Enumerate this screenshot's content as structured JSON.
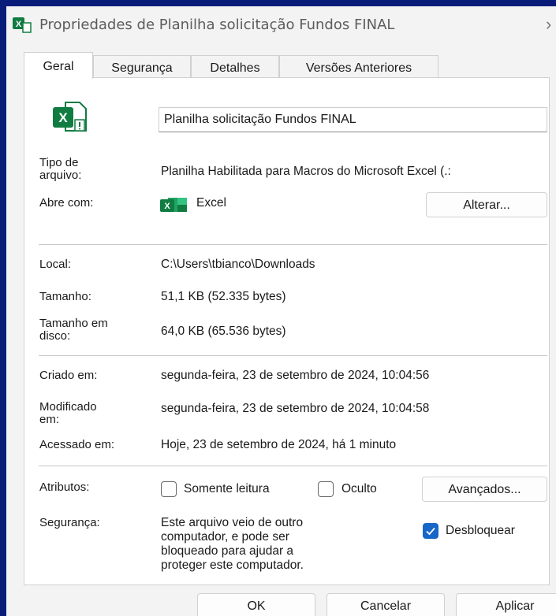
{
  "window": {
    "title": "Propriedades de Planilha solicitação Fundos FINAL",
    "close_glyph": "›"
  },
  "tabs": [
    {
      "label": "Geral",
      "active": true
    },
    {
      "label": "Segurança",
      "active": false
    },
    {
      "label": "Detalhes",
      "active": false
    },
    {
      "label": "Versões Anteriores",
      "active": false
    }
  ],
  "file": {
    "icon": "excel-file-icon",
    "icon_letter": "X",
    "name": "Planilha solicitação Fundos FINAL"
  },
  "type_info": {
    "tipo_label_1": "Tipo de",
    "tipo_label_2": "arquivo:",
    "tipo_value": "Planilha Habilitada para Macros do Microsoft Excel (.:",
    "abre_label": "Abre com:",
    "app_icon": "excel-app-icon",
    "app_icon_letter": "X",
    "app_name": "Excel",
    "change_button": "Alterar..."
  },
  "location": {
    "local_label": "Local:",
    "local_value": "C:\\Users\\tbianco\\Downloads",
    "size_label": "Tamanho:",
    "size_value": "51,1 KB (52.335 bytes)",
    "disk_label_1": "Tamanho em",
    "disk_label_2": "disco:",
    "disk_value": "64,0 KB (65.536 bytes)"
  },
  "dates": {
    "created_label": "Criado em:",
    "created_value": "segunda-feira, 23 de setembro de 2024, 10:04:56",
    "modified_label_1": "Modificado",
    "modified_label_2": "em:",
    "modified_value": "segunda-feira, 23 de setembro de 2024, 10:04:58",
    "accessed_label": "Acessado em:",
    "accessed_value": "Hoje, 23 de setembro de 2024, há 1 minuto"
  },
  "attributes": {
    "label": "Atributos:",
    "readonly_label": "Somente leitura",
    "readonly_checked": false,
    "hidden_label": "Oculto",
    "hidden_checked": false,
    "advanced_button": "Avançados..."
  },
  "security": {
    "label": "Segurança:",
    "line1": "Este arquivo veio de outro",
    "line2": "computador, e pode ser",
    "line3": "bloqueado para ajudar a",
    "line4": "proteger este computador.",
    "unblock_label": "Desbloquear",
    "unblock_checked": true
  },
  "footer": {
    "ok": "OK",
    "cancel": "Cancelar",
    "apply": "Aplicar"
  },
  "colors": {
    "background": "#0a1c7a",
    "excel_green": "#107c41",
    "accent_blue": "#1667c8"
  }
}
